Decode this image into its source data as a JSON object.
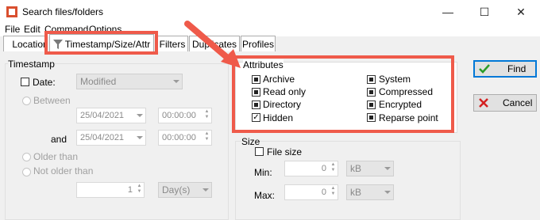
{
  "window": {
    "title": "Search files/folders",
    "controls": {
      "minimize": "—",
      "maximize": "☐",
      "close": "✕"
    }
  },
  "menu": {
    "items": [
      "File",
      "Edit",
      "Command",
      "Options"
    ]
  },
  "tabs": [
    "Location",
    "Timestamp/Size/Attr",
    "Filters",
    "Duplicates",
    "Profiles"
  ],
  "active_tab": "Timestamp/Size/Attr",
  "timestamp": {
    "group_label": "Timestamp",
    "date_label": "Date:",
    "date_mode": "Modified",
    "between_label": "Between",
    "and_label": "and",
    "date_from": "25/04/2021",
    "time_from": "00:00:00",
    "date_to": "25/04/2021",
    "time_to": "00:00:00",
    "older_than_label": "Older than",
    "not_older_than_label": "Not older than",
    "age_value": "1",
    "age_unit": "Day(s)"
  },
  "attributes": {
    "group_label": "Attributes",
    "items": [
      {
        "label": "Archive",
        "state": "indeterminate"
      },
      {
        "label": "Read only",
        "state": "indeterminate"
      },
      {
        "label": "Directory",
        "state": "indeterminate"
      },
      {
        "label": "Hidden",
        "state": "checked"
      },
      {
        "label": "System",
        "state": "indeterminate"
      },
      {
        "label": "Compressed",
        "state": "indeterminate"
      },
      {
        "label": "Encrypted",
        "state": "indeterminate"
      },
      {
        "label": "Reparse point",
        "state": "indeterminate"
      }
    ]
  },
  "size": {
    "group_label": "Size",
    "file_size_label": "File size",
    "min_label": "Min:",
    "max_label": "Max:",
    "min_value": "0",
    "max_value": "0",
    "min_unit": "kB",
    "max_unit": "kB"
  },
  "buttons": {
    "find": "Find",
    "cancel": "Cancel"
  },
  "icons": {
    "find": "checkmark-icon",
    "cancel": "x-icon",
    "tab": "funnel-icon"
  },
  "colors": {
    "highlight": "#ef5a4a",
    "find_check": "#2a9d2a",
    "cancel_x": "#d42020"
  }
}
